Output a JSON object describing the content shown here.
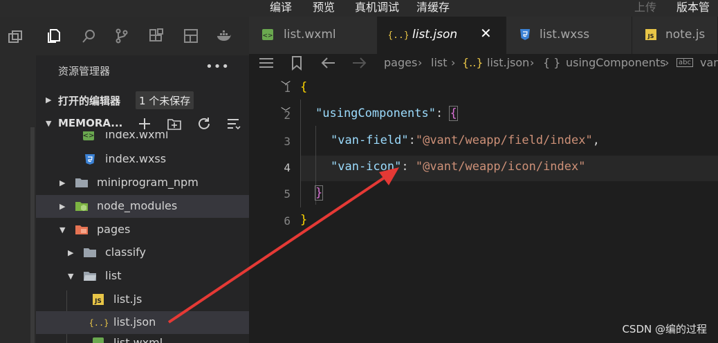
{
  "menubar": {
    "items": [
      "编译",
      "预览",
      "真机调试",
      "清缓存"
    ],
    "upload": "上传",
    "version": "版本管"
  },
  "explorer": {
    "title": "资源管理器",
    "more": "•••",
    "open_editors": "打开的编辑器",
    "unsaved_badge": "1 个未保存",
    "project": "MEMORA...",
    "tree": [
      {
        "name": "index.wxml",
        "icon": "wxml-icon"
      },
      {
        "name": "index.wxss",
        "icon": "css-icon"
      },
      {
        "name": "miniprogram_npm",
        "icon": "folder-icon"
      },
      {
        "name": "node_modules",
        "icon": "node-folder-icon"
      },
      {
        "name": "pages",
        "icon": "pages-folder-icon"
      },
      {
        "name": "classify",
        "icon": "folder-icon"
      },
      {
        "name": "list",
        "icon": "folder-open-icon"
      },
      {
        "name": "list.js",
        "icon": "js-icon"
      },
      {
        "name": "list.json",
        "icon": "json-icon"
      },
      {
        "name": "list.wxml",
        "icon": "wxml-icon"
      }
    ]
  },
  "tabs": [
    {
      "name": "list.wxml",
      "icon": "wxml-icon"
    },
    {
      "name": "list.json",
      "icon": "json-icon",
      "active": true,
      "close": "✕"
    },
    {
      "name": "list.wxss",
      "icon": "css-icon"
    },
    {
      "name": "note.js",
      "icon": "js-icon"
    }
  ],
  "breadcrumb": {
    "items": [
      "pages",
      "list",
      "list.json",
      "usingComponents",
      "van"
    ],
    "json_glyph": "{..}",
    "obj_glyph": "{ }",
    "abc_glyph": "abc"
  },
  "editor": {
    "line_numbers": [
      "1",
      "2",
      "3",
      "4",
      "5",
      "6"
    ],
    "line1": "{",
    "line2_key": "\"usingComponents\"",
    "line2_colon": ": ",
    "line2_brace": "{",
    "line3_key": "\"van-field\"",
    "line3_colon": ":",
    "line3_val": "\"@vant/weapp/field/index\"",
    "line3_comma": ",",
    "line4_key": "\"van-icon\"",
    "line4_colon": ": ",
    "line4_val": "\"@vant/weapp/icon/index\"",
    "line5": "}",
    "line6": "}"
  },
  "watermark": "CSDN @编的过程",
  "colors": {
    "arrow": "#e53935",
    "accent": "#007acc"
  }
}
